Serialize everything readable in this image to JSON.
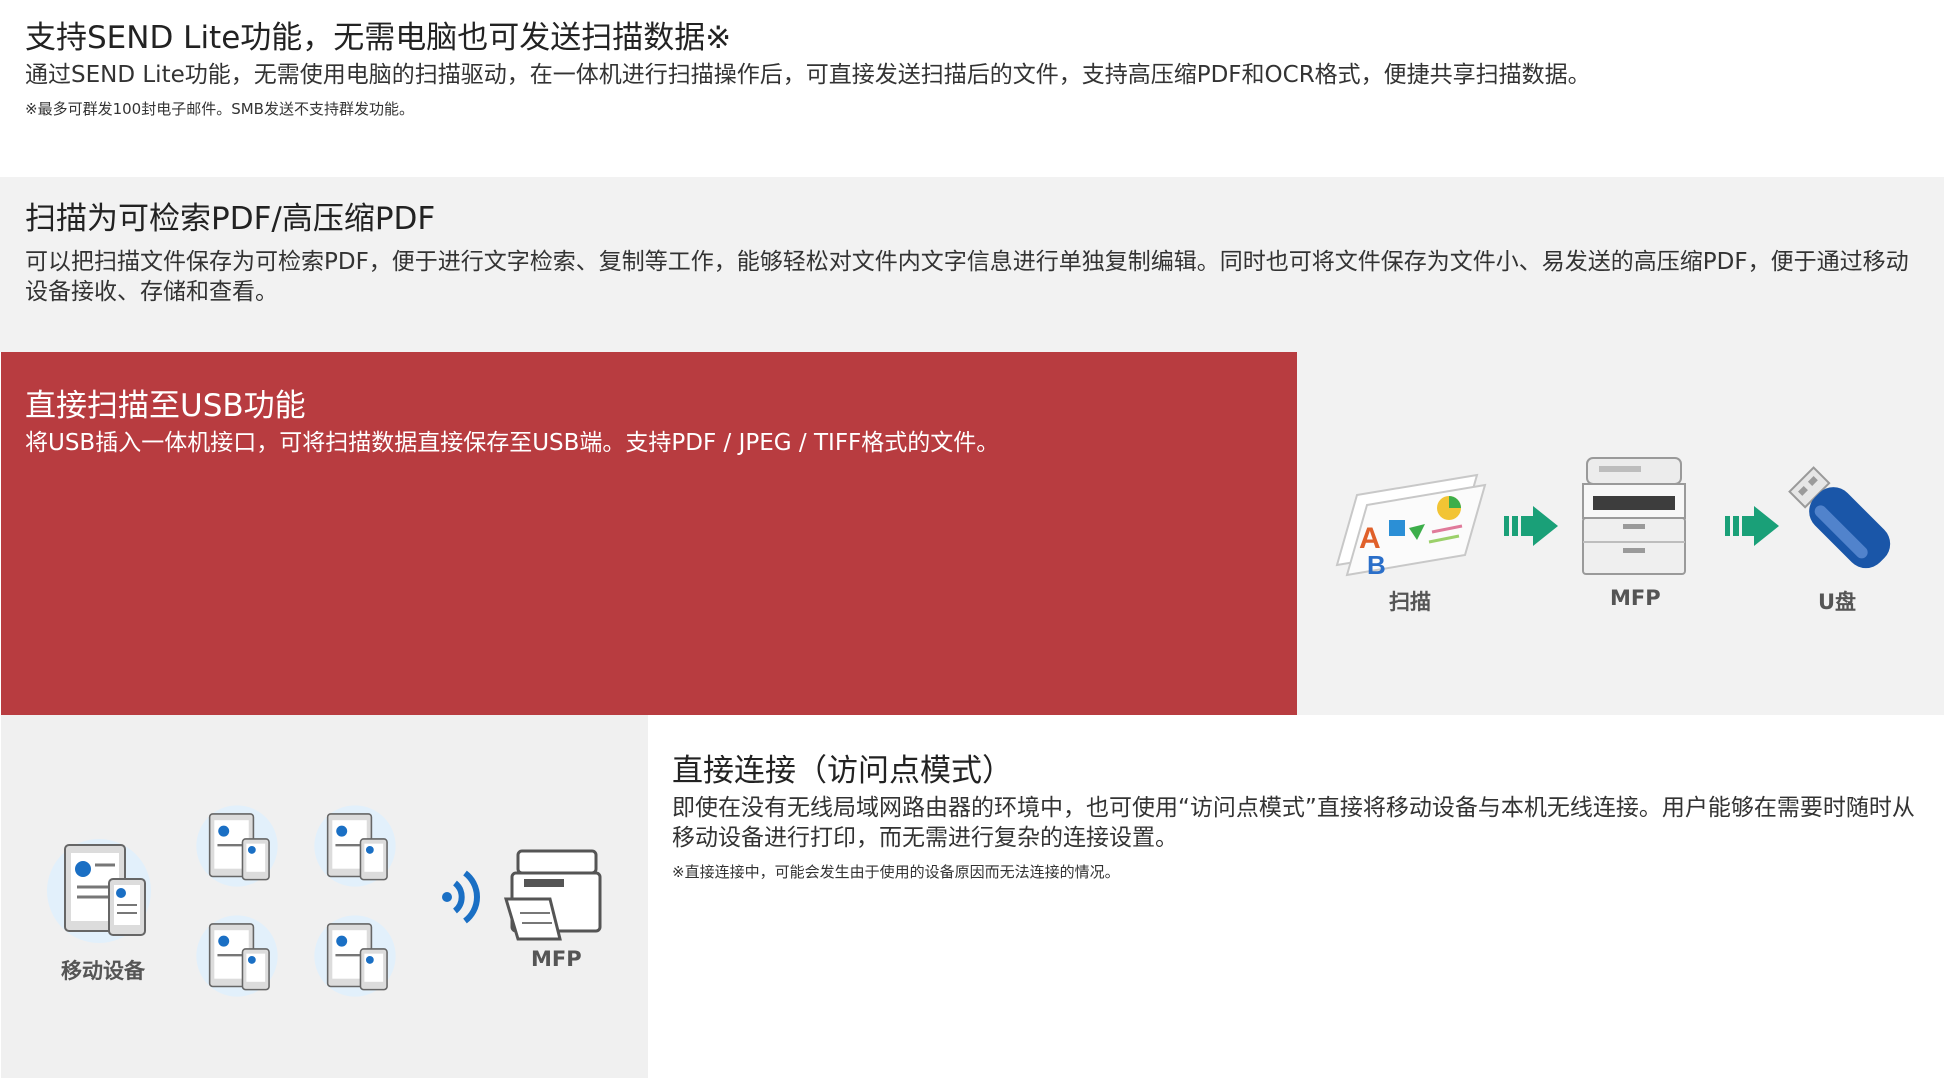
{
  "sections": {
    "send_lite": {
      "title": "支持SEND Lite功能，无需电脑也可发送扫描数据※",
      "description": "通过SEND Lite功能，无需使用电脑的扫描驱动，在一体机进行扫描操作后，可直接发送扫描后的文件，支持高压缩PDF和OCR格式，便捷共享扫描数据。",
      "note": "※最多可群发100封电子邮件。SMB发送不支持群发功能。"
    },
    "searchable_pdf": {
      "title": "扫描为可检索PDF/高压缩PDF",
      "description": "可以把扫描文件保存为可检索PDF，便于进行文字检索、复制等工作，能够轻松对文件内文字信息进行单独复制编辑。同时也可将文件保存为文件小、易发送的高压缩PDF，便于通过移动设备接收、存储和查看。"
    },
    "scan_to_usb": {
      "title": "直接扫描至USB功能",
      "description": "将USB插入一体机接口，可将扫描数据直接保存至USB端。支持PDF / JPEG / TIFF格式的文件。",
      "illustration": {
        "scan_label": "扫描",
        "mfp_label": "MFP",
        "usb_label": "U盘"
      }
    },
    "direct_connection": {
      "title": "直接连接（访问点模式）",
      "description": "即使在没有无线局域网路由器的环境中，也可使用“访问点模式”直接将移动设备与本机无线连接。用户能够在需要时随时从移动设备进行打印，而无需进行复杂的连接设置。",
      "note": "※直接连接中，可能会发生由于使用的设备原因而无法连接的情况。",
      "illustration": {
        "mobile_label": "移动设备",
        "mfp_label": "MFP"
      }
    }
  },
  "colors": {
    "red_panel": "#b83c40",
    "gray_panel": "#f2f2f2",
    "arrow_green": "#1aa078",
    "usb_blue": "#1a56a8"
  }
}
